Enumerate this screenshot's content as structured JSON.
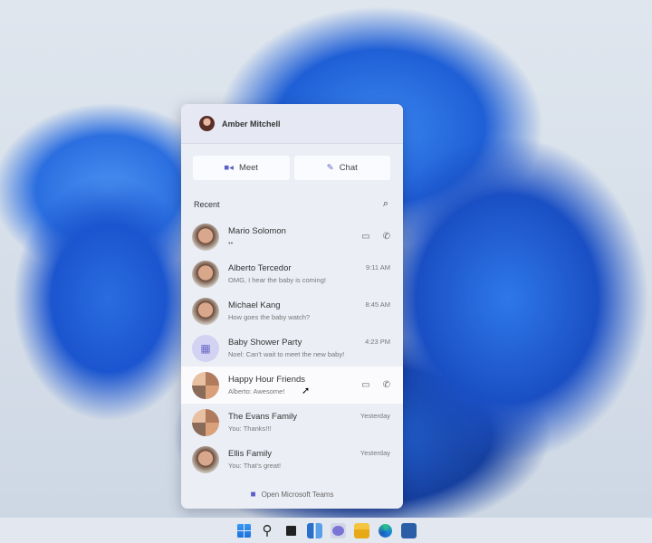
{
  "user": {
    "name": "Amber Mitchell"
  },
  "actions": {
    "meet": "Meet",
    "chat": "Chat"
  },
  "recent_label": "Recent",
  "chats": [
    {
      "name": "Mario Solomon",
      "preview": "••",
      "time": "",
      "calls": true
    },
    {
      "name": "Alberto Tercedor",
      "preview": "OMG, I hear the baby is coming!",
      "time": "9:11 AM"
    },
    {
      "name": "Michael Kang",
      "preview": "How goes the baby watch?",
      "time": "8:45 AM"
    },
    {
      "name": "Baby Shower Party",
      "preview": "Noel: Can't wait to meet the new baby!",
      "time": "4:23 PM"
    },
    {
      "name": "Happy Hour Friends",
      "preview": "Alberto: Awesome!",
      "time": "",
      "calls": true
    },
    {
      "name": "The Evans Family",
      "preview": "You: Thanks!!!",
      "time": "Yesterday"
    },
    {
      "name": "Ellis Family",
      "preview": "You: That's great!",
      "time": "Yesterday"
    }
  ],
  "footer": "Open Microsoft Teams",
  "taskbar": [
    "start-icon",
    "search-icon",
    "task-view-icon",
    "widgets-icon",
    "teams-chat-icon",
    "file-explorer-icon",
    "edge-icon",
    "store-icon"
  ]
}
